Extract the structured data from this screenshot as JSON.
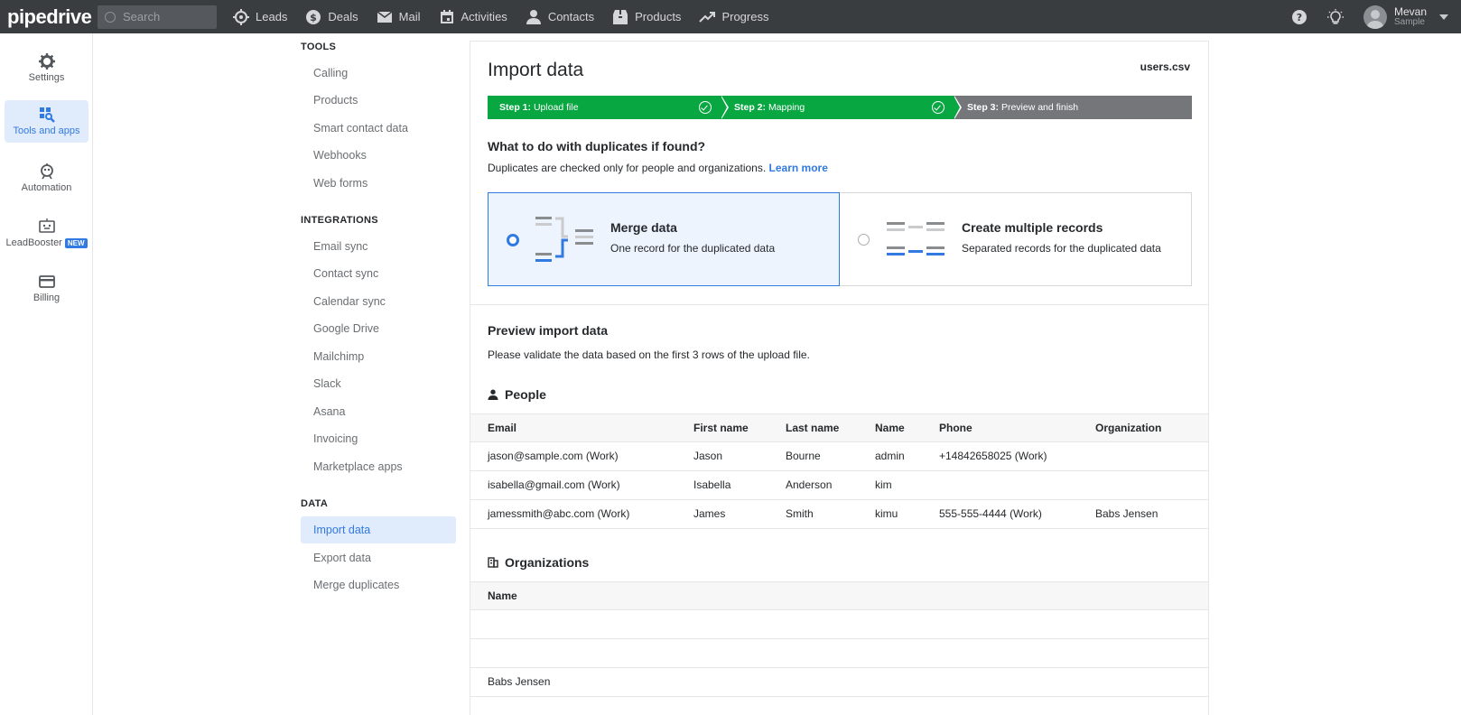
{
  "app": {
    "logo": "pipedrive"
  },
  "topbar": {
    "search_placeholder": "Search",
    "nav": [
      {
        "label": "Leads",
        "icon": "target-icon"
      },
      {
        "label": "Deals",
        "icon": "dollar-icon"
      },
      {
        "label": "Mail",
        "icon": "mail-icon"
      },
      {
        "label": "Activities",
        "icon": "calendar-icon"
      },
      {
        "label": "Contacts",
        "icon": "person-icon"
      },
      {
        "label": "Products",
        "icon": "box-icon"
      },
      {
        "label": "Progress",
        "icon": "trend-icon"
      }
    ],
    "user": {
      "name": "Mevan",
      "company": "Sample"
    }
  },
  "rail": {
    "items": [
      {
        "label": "Settings",
        "icon": "gear-icon"
      },
      {
        "label": "Tools and apps",
        "icon": "tools-icon"
      },
      {
        "label": "Automation",
        "icon": "robot-icon"
      },
      {
        "label": "LeadBooster",
        "badge": "NEW",
        "icon": "bot-icon"
      },
      {
        "label": "Billing",
        "icon": "card-icon"
      }
    ]
  },
  "menu": {
    "tools_title": "TOOLS",
    "tools": [
      "Calling",
      "Products",
      "Smart contact data",
      "Webhooks",
      "Web forms"
    ],
    "integrations_title": "INTEGRATIONS",
    "integrations": [
      "Email sync",
      "Contact sync",
      "Calendar sync",
      "Google Drive",
      "Mailchimp",
      "Slack",
      "Asana",
      "Invoicing",
      "Marketplace apps"
    ],
    "data_title": "DATA",
    "data": [
      "Import data",
      "Export data",
      "Merge duplicates"
    ]
  },
  "main": {
    "title": "Import data",
    "filename": "users.csv",
    "steps": [
      {
        "num": "Step 1:",
        "label": "Upload file"
      },
      {
        "num": "Step 2:",
        "label": "Mapping"
      },
      {
        "num": "Step 3:",
        "label": "Preview and finish"
      }
    ],
    "dup_title": "What to do with duplicates if found?",
    "dup_sub": "Duplicates are checked only for people and organizations.",
    "learn_more": "Learn more",
    "options": [
      {
        "title": "Merge data",
        "sub": "One record for the duplicated data"
      },
      {
        "title": "Create multiple records",
        "sub": "Separated records for the duplicated data"
      }
    ],
    "preview_title": "Preview import data",
    "preview_sub": "Please validate the data based on the first 3 rows of the upload file.",
    "people": {
      "title": "People",
      "columns": [
        "Email",
        "First name",
        "Last name",
        "Name",
        "Phone",
        "Organization"
      ],
      "rows": [
        [
          "jason@sample.com (Work)",
          "Jason",
          "Bourne",
          "admin",
          "+14842658025 (Work)",
          ""
        ],
        [
          "isabella@gmail.com (Work)",
          "Isabella",
          "Anderson",
          "kim",
          "",
          ""
        ],
        [
          "jamessmith@abc.com (Work)",
          "James",
          "Smith",
          "kimu",
          "555-555-4444 (Work)",
          "Babs Jensen"
        ]
      ]
    },
    "organizations": {
      "title": "Organizations",
      "columns": [
        "Name"
      ],
      "rows": [
        [
          ""
        ],
        [
          ""
        ],
        [
          "Babs Jensen"
        ]
      ]
    }
  }
}
